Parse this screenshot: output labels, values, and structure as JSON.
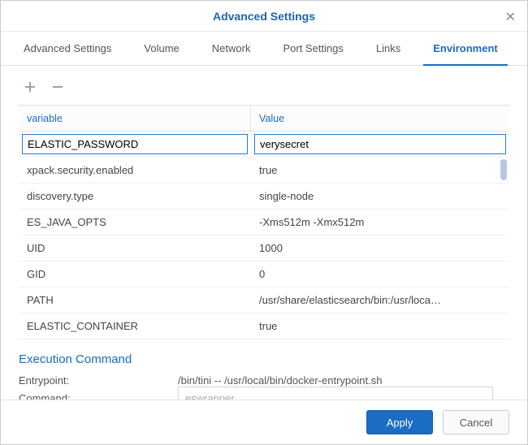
{
  "title": "Advanced Settings",
  "tabs": [
    {
      "label": "Advanced Settings",
      "active": false
    },
    {
      "label": "Volume",
      "active": false
    },
    {
      "label": "Network",
      "active": false
    },
    {
      "label": "Port Settings",
      "active": false
    },
    {
      "label": "Links",
      "active": false
    },
    {
      "label": "Environment",
      "active": true
    }
  ],
  "columns": {
    "variable": "variable",
    "value": "Value"
  },
  "env": [
    {
      "name": "ELASTIC_PASSWORD",
      "value": "verysecret",
      "selected": true
    },
    {
      "name": "xpack.security.enabled",
      "value": "true"
    },
    {
      "name": "discovery.type",
      "value": "single-node"
    },
    {
      "name": "ES_JAVA_OPTS",
      "value": "-Xms512m -Xmx512m"
    },
    {
      "name": "UID",
      "value": "1000"
    },
    {
      "name": "GID",
      "value": "0"
    },
    {
      "name": "PATH",
      "value": "/usr/share/elasticsearch/bin:/usr/loca…"
    },
    {
      "name": "ELASTIC_CONTAINER",
      "value": "true"
    }
  ],
  "exec": {
    "title": "Execution Command",
    "entrypoint_label": "Entrypoint:",
    "entrypoint_value": "/bin/tini -- /usr/local/bin/docker-entrypoint.sh",
    "command_label": "Command:",
    "command_placeholder": "eswrapper"
  },
  "buttons": {
    "apply": "Apply",
    "cancel": "Cancel"
  }
}
